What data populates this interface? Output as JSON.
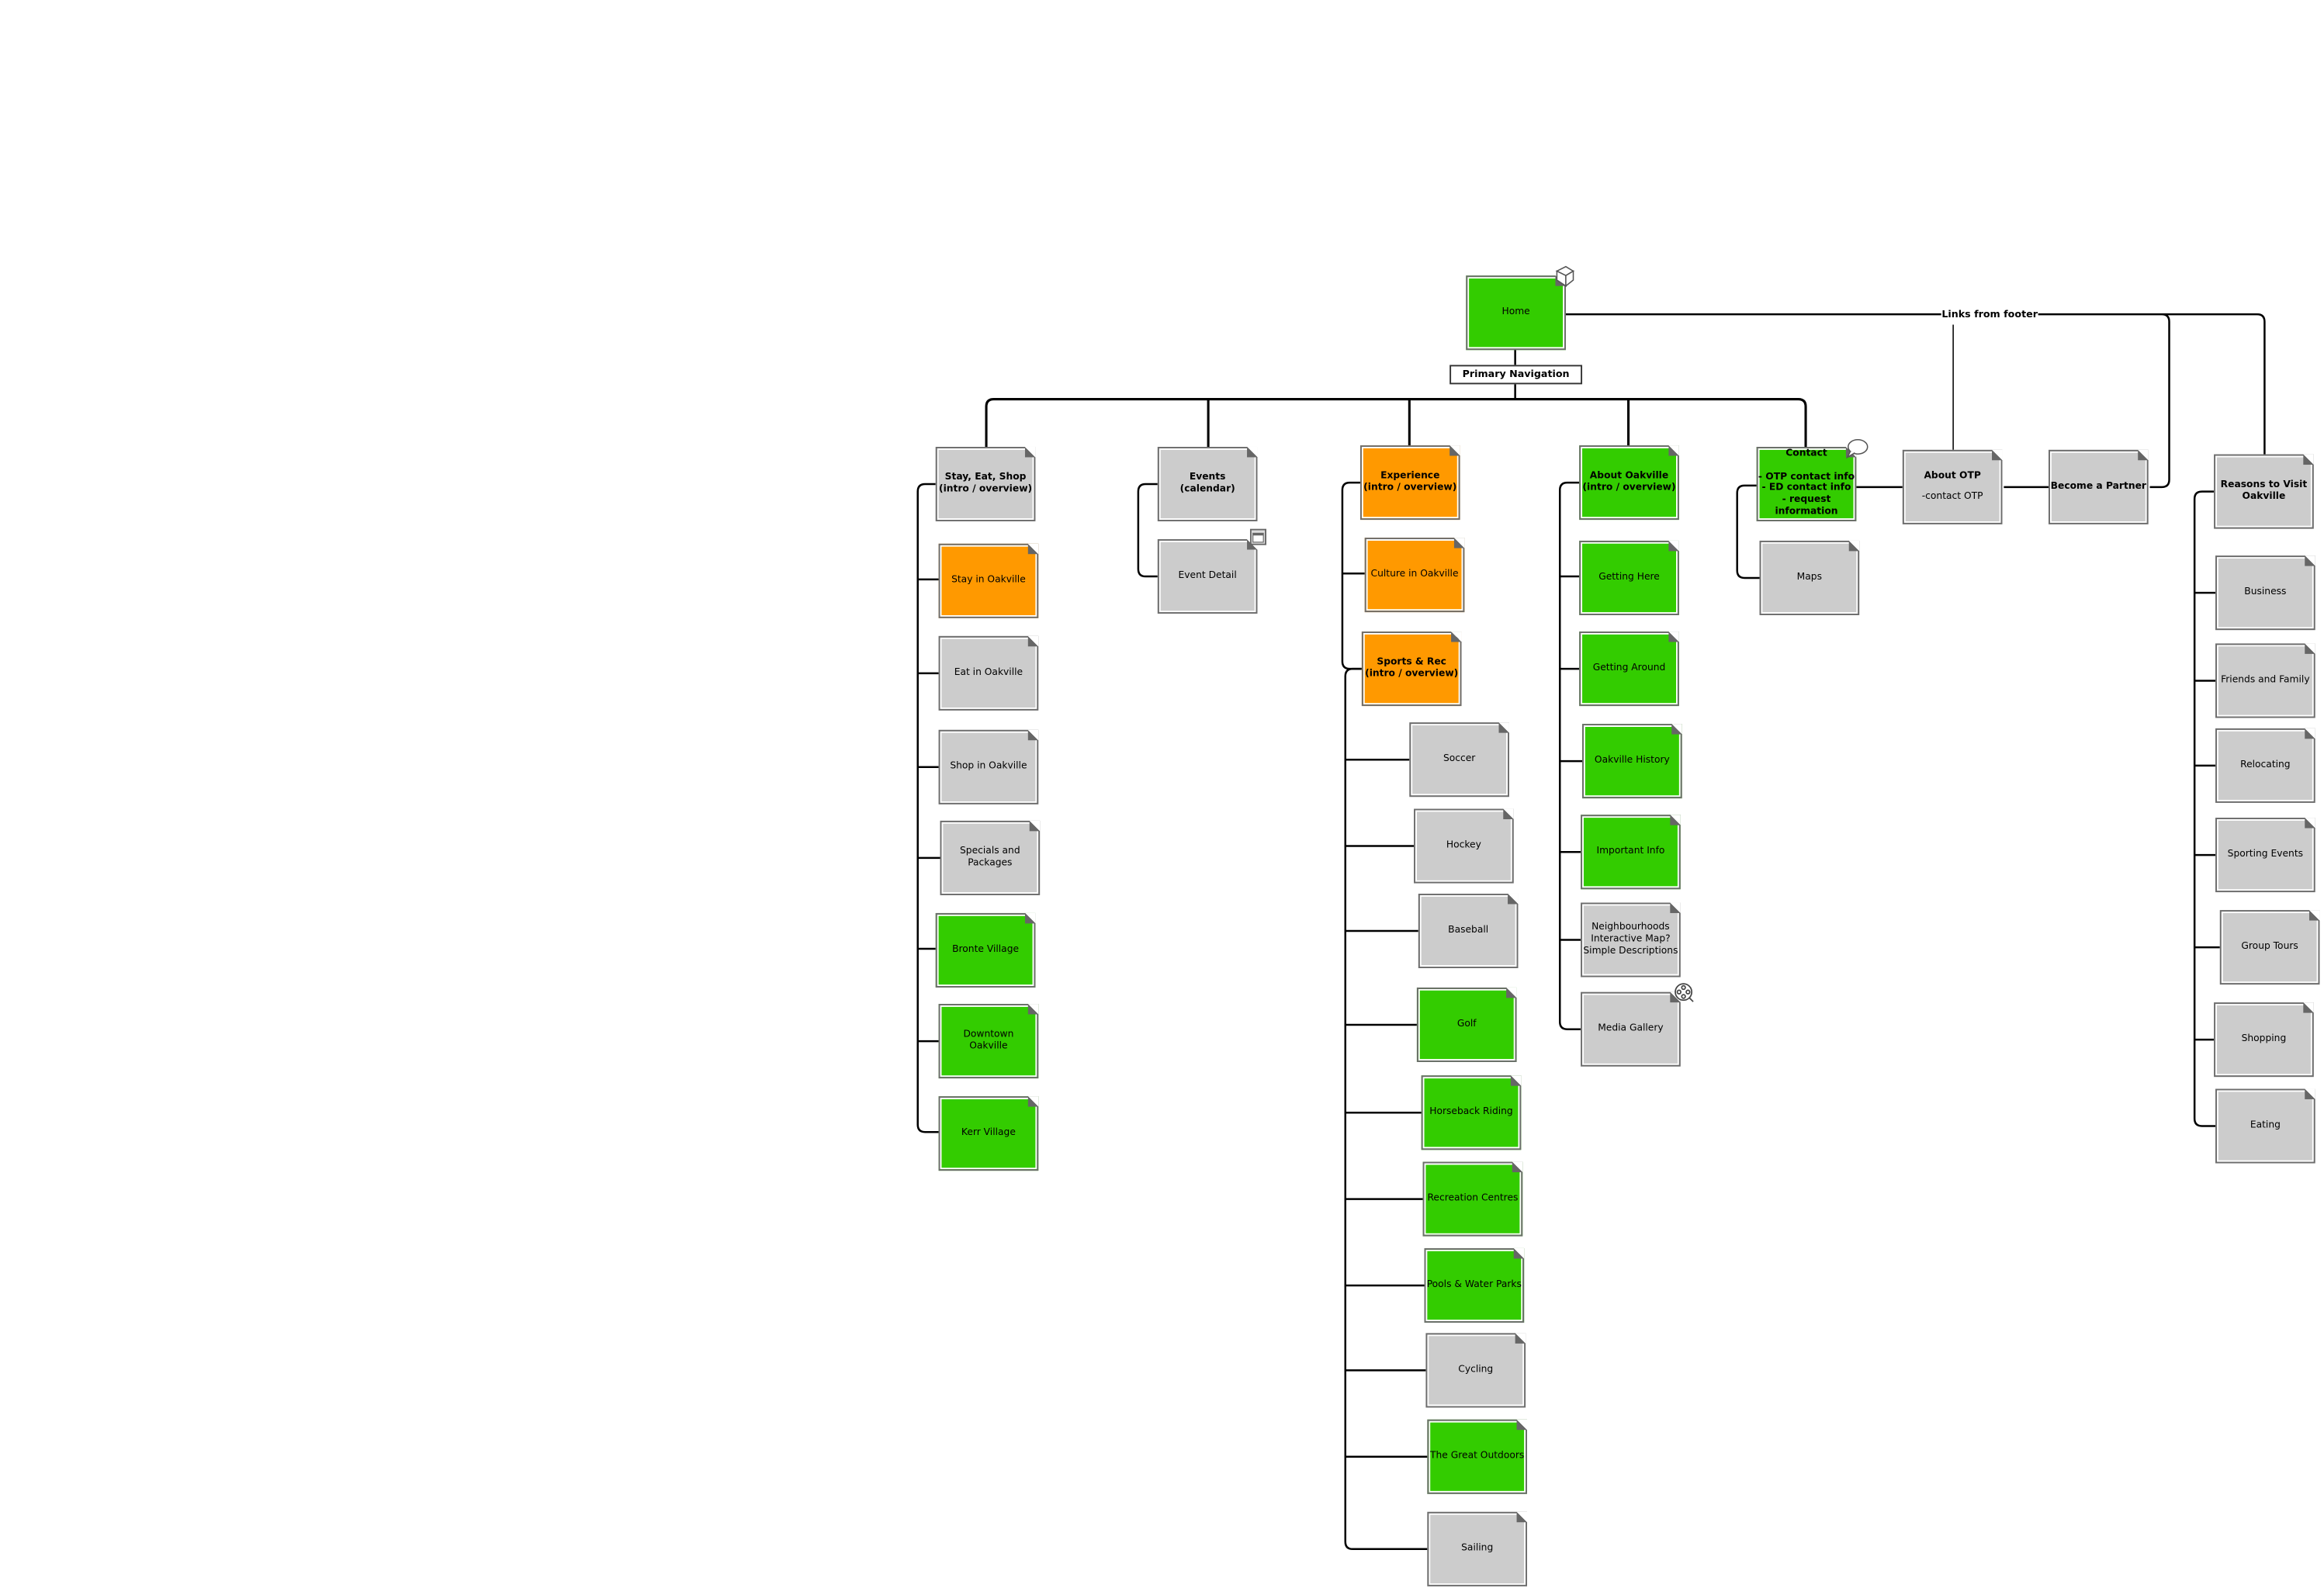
{
  "labels": {
    "primary_navigation": "Primary Navigation",
    "links_from_footer": "Links from footer"
  },
  "colors": {
    "green": "#33cc00",
    "orange": "#ff9900",
    "gray": "#cccccc"
  },
  "nodes": [
    {
      "label": "Home",
      "color": "green",
      "icon": "cube-icon"
    },
    {
      "label": "Stay, Eat, Shop\n(intro / overview)",
      "color": "gray",
      "bold": true
    },
    {
      "label": "Stay in Oakville",
      "color": "orange"
    },
    {
      "label": "Eat in Oakville",
      "color": "gray"
    },
    {
      "label": "Shop in Oakville",
      "color": "gray"
    },
    {
      "label": "Specials and\nPackages",
      "color": "gray"
    },
    {
      "label": "Bronte Village",
      "color": "green"
    },
    {
      "label": "Downtown\nOakville",
      "color": "green"
    },
    {
      "label": "Kerr Village",
      "color": "green"
    },
    {
      "label": "Events\n(calendar)",
      "color": "gray",
      "bold": true
    },
    {
      "label": "Event Detail",
      "color": "gray",
      "icon": "calendar-icon"
    },
    {
      "label": "Experience\n(intro / overview)",
      "color": "orange",
      "bold": true
    },
    {
      "label": "Culture in Oakville",
      "color": "orange"
    },
    {
      "label": "Sports & Rec\n(intro / overview)",
      "color": "orange",
      "bold": true
    },
    {
      "label": "Soccer",
      "color": "gray"
    },
    {
      "label": "Hockey",
      "color": "gray"
    },
    {
      "label": "Baseball",
      "color": "gray"
    },
    {
      "label": "Golf",
      "color": "green"
    },
    {
      "label": "Horseback Riding",
      "color": "green"
    },
    {
      "label": "Recreation Centres",
      "color": "green"
    },
    {
      "label": "Pools & Water Parks",
      "color": "green"
    },
    {
      "label": "Cycling",
      "color": "gray"
    },
    {
      "label": "The Great Outdoors",
      "color": "green"
    },
    {
      "label": "Sailing",
      "color": "gray"
    },
    {
      "label": "About Oakville\n(intro / overview)",
      "color": "green",
      "bold": true
    },
    {
      "label": "Getting Here",
      "color": "green"
    },
    {
      "label": "Getting Around",
      "color": "green"
    },
    {
      "label": "Oakville History",
      "color": "green"
    },
    {
      "label": "Important Info",
      "color": "green"
    },
    {
      "label": "Neighbourhoods\nInteractive Map?\nSimple Descriptions",
      "color": "gray"
    },
    {
      "label": "Media Gallery",
      "color": "gray",
      "icon": "film-reel-icon"
    },
    {
      "label": "Contact\n\n- OTP contact info\n- ED contact info\n- request\ninformation",
      "color": "green",
      "bold": true,
      "icon": "speech-bubble-icon"
    },
    {
      "label": "Maps",
      "color": "gray"
    },
    {
      "label": "About OTP",
      "sub": "-contact OTP",
      "color": "gray",
      "bold": true
    },
    {
      "label": "Become a Partner",
      "color": "gray",
      "bold": true
    },
    {
      "label": "Reasons to Visit\nOakville",
      "color": "gray",
      "bold": true
    },
    {
      "label": "Business",
      "color": "gray"
    },
    {
      "label": "Friends and Family",
      "color": "gray"
    },
    {
      "label": "Relocating",
      "color": "gray"
    },
    {
      "label": "Sporting Events",
      "color": "gray"
    },
    {
      "label": "Group Tours",
      "color": "gray"
    },
    {
      "label": "Shopping",
      "color": "gray"
    },
    {
      "label": "Eating",
      "color": "gray"
    }
  ]
}
